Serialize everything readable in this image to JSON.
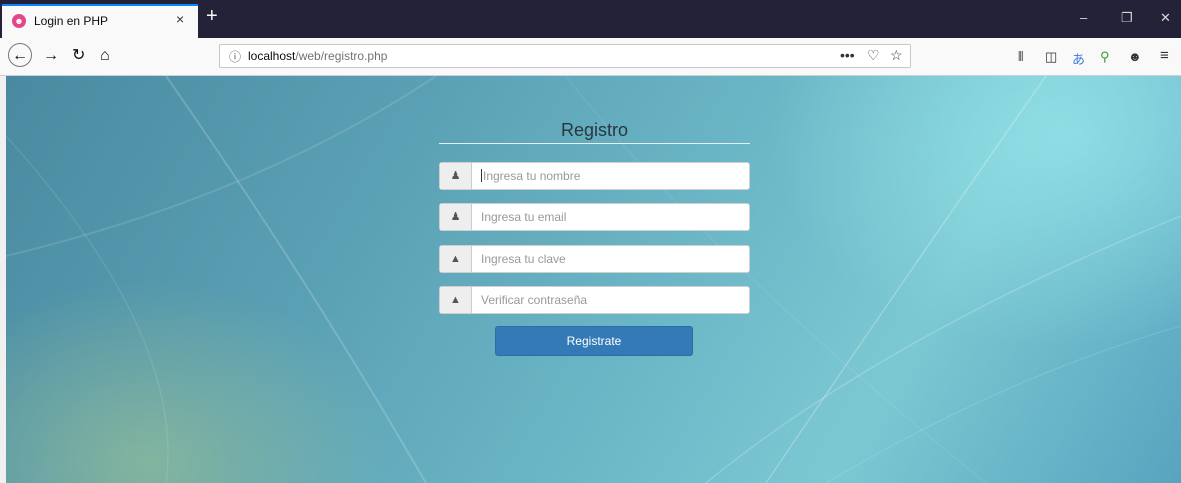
{
  "browser": {
    "tab_title": "Login en PHP",
    "tab_favicon": "☻",
    "tab_close": "×",
    "new_tab": "+",
    "window_controls": {
      "minimize": "–",
      "restore": "❐",
      "close": "✕"
    },
    "nav": {
      "back": "←",
      "forward": "→",
      "reload": "↻",
      "home": "⌂"
    },
    "url_host": "localhost",
    "url_path": "/web/registro.php",
    "url_info": "ⓘ",
    "url_actions": {
      "more": "•••",
      "pocket": "♡",
      "bookmark": "☆"
    },
    "toolbar_icons": {
      "library": "⫴",
      "sidebar": "◫",
      "translate": "あ",
      "search_ext": "⚲",
      "account": "☻",
      "menu": "≡"
    }
  },
  "form": {
    "title": "Registro",
    "fields": [
      {
        "icon": "user-icon",
        "glyph": "♟",
        "placeholder": "Ingresa tu nombre",
        "focused": true
      },
      {
        "icon": "user-icon",
        "glyph": "♟",
        "placeholder": "Ingresa tu email",
        "focused": false
      },
      {
        "icon": "lock-icon",
        "glyph": "▲",
        "placeholder": "Ingresa tu clave",
        "focused": false
      },
      {
        "icon": "lock-icon",
        "glyph": "▲",
        "placeholder": "Verificar contraseña",
        "focused": false
      }
    ],
    "submit_label": "Registrate"
  },
  "colors": {
    "titlebar": "#232238",
    "button": "#337ab7",
    "accent_tab": "#0a84ff"
  }
}
